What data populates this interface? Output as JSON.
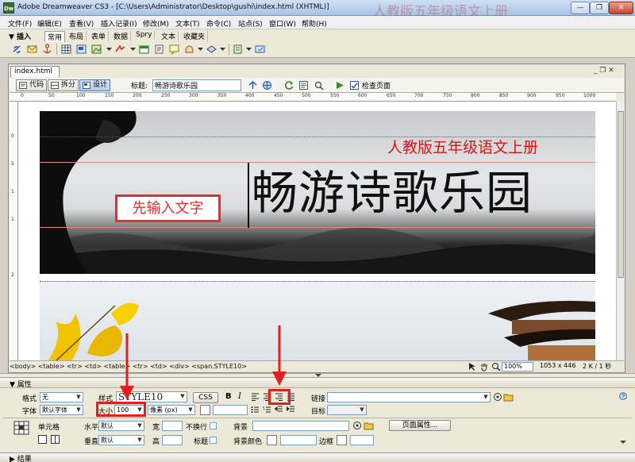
{
  "window": {
    "title": "Adobe Dreamweaver CS3 - [C:\\Users\\Administrator\\Desktop\\gushi\\index.html (XHTML)]",
    "icon_label": "Dw",
    "overlay_text": "人教版五年级语文上册",
    "minimize": "—",
    "maximize": "❐",
    "close": "✕"
  },
  "menu": [
    "文件(F)",
    "编辑(E)",
    "查看(V)",
    "插入记录(I)",
    "修改(M)",
    "文本(T)",
    "命令(C)",
    "站点(S)",
    "窗口(W)",
    "帮助(H)"
  ],
  "insert_bar": {
    "label": "▼ 插入",
    "tabs": [
      "常用",
      "布局",
      "表单",
      "数据",
      "Spry",
      "文本",
      "收藏夹"
    ],
    "active_tab": "常用"
  },
  "document": {
    "tab_label": "index.html",
    "window_controls": "_ ❐ ✕",
    "view_buttons": [
      "代码",
      "拆分",
      "设计"
    ],
    "active_view": "设计",
    "title_label": "标题:",
    "title_value": "畅游诗歌乐园",
    "check_page_label": "检查页面"
  },
  "ruler": {
    "h_labels": [
      "0",
      "50",
      "100",
      "150",
      "200",
      "250",
      "300",
      "350",
      "400",
      "450",
      "500",
      "550",
      "600",
      "650",
      "700",
      "750",
      "800",
      "850",
      "900",
      "950",
      "1000"
    ],
    "v_labels": [
      "0",
      "5",
      "1",
      "1",
      "2"
    ]
  },
  "canvas": {
    "subtitle": "人教版五年级语文上册",
    "main_title": "畅游诗歌乐园",
    "annotation": "先输入文字"
  },
  "status": {
    "tag_path": "<body> <table> <tr> <td> <table> <tr> <td> <div> <span.STYLE10>",
    "zoom": "100%",
    "size": "1053 x 446",
    "filesize": "2 K / 1 秒"
  },
  "properties": {
    "title": "▼ 属性",
    "format_label": "格式",
    "format_value": "无",
    "style_label": "样式",
    "style_value": "STYLE10",
    "css_button": "CSS",
    "bold": "B",
    "italic": "I",
    "link_label": "链接",
    "font_label": "字体",
    "font_value": "默认字体",
    "size_label": "大小",
    "size_value": "100",
    "unit_value": "像素 (px)",
    "target_label": "目标",
    "cell_label": "单元格",
    "horz_label": "水平",
    "horz_value": "默认",
    "vert_label": "垂直",
    "vert_value": "默认",
    "width_label": "宽",
    "height_label": "高",
    "nowrap_label": "不换行",
    "header_label": "标题",
    "bg_label": "背景",
    "bgcolor_label": "背景颜色",
    "border_label": "边框",
    "page_props_button": "页面属性..."
  },
  "results": {
    "title": "▶ 结果"
  },
  "colors": {
    "accent_red": "#e02020",
    "subtitle_red": "#d01818",
    "panel_bg": "#ece9d8"
  }
}
